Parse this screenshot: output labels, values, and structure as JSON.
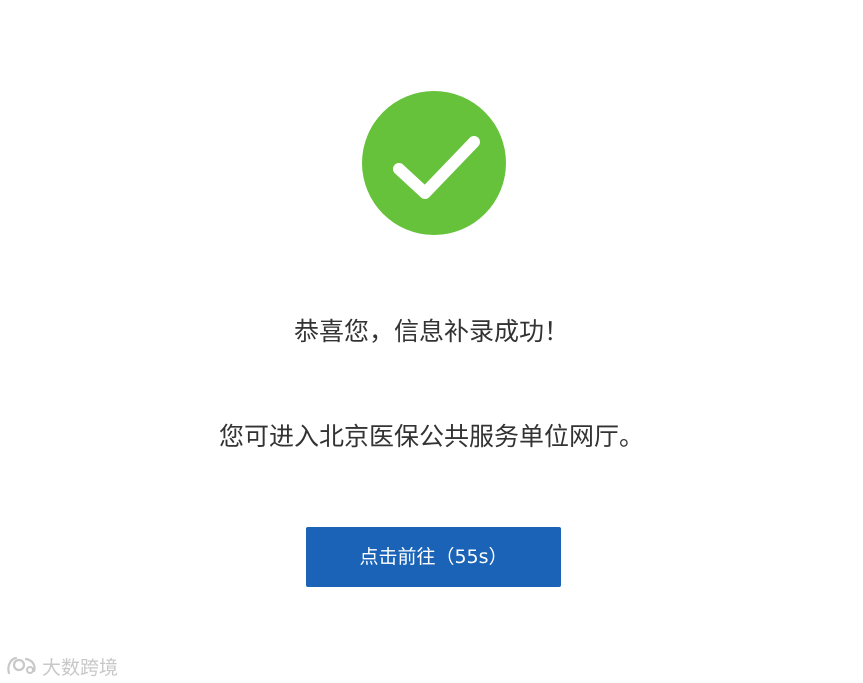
{
  "status": {
    "icon": "check-circle-icon",
    "color": "#66c23a"
  },
  "messages": {
    "success": "恭喜您，信息补录成功！",
    "next_step": "您可进入北京医保公共服务单位网厅。"
  },
  "button": {
    "label": "点击前往（55s）",
    "color": "#1a63b6"
  },
  "watermark": {
    "text": "大数跨境",
    "icon": "watermark-logo-icon"
  }
}
